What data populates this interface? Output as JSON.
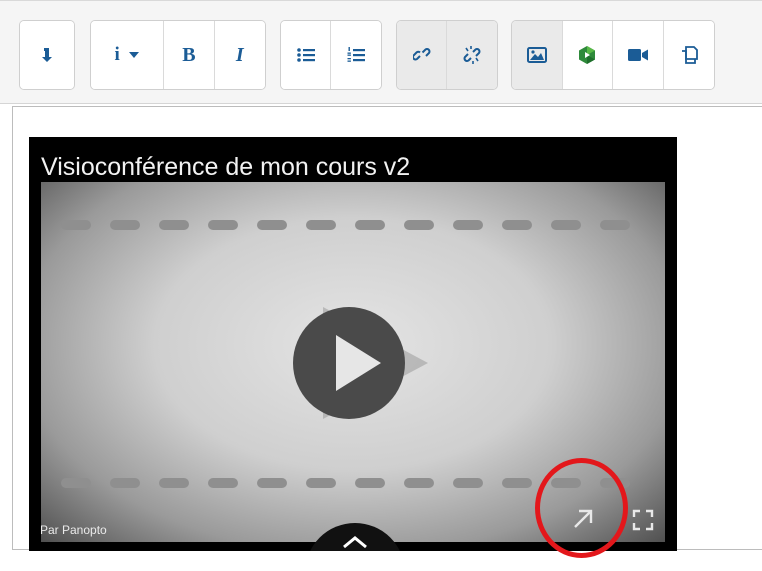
{
  "toolbar": {
    "groups": [
      {
        "buttons": [
          {
            "name": "collapse-toolbar",
            "icon": "arrow-down-icon"
          }
        ]
      },
      {
        "buttons": [
          {
            "name": "paragraph-styles",
            "label": "i",
            "icon": "info-icon"
          },
          {
            "name": "bold",
            "label": "B"
          },
          {
            "name": "italic",
            "label": "I"
          }
        ]
      },
      {
        "buttons": [
          {
            "name": "unordered-list",
            "icon": "bulleted-list-icon"
          },
          {
            "name": "ordered-list",
            "icon": "numbered-list-icon"
          }
        ]
      },
      {
        "buttons": [
          {
            "name": "link",
            "icon": "link-icon"
          },
          {
            "name": "unlink",
            "icon": "unlink-icon"
          }
        ]
      },
      {
        "buttons": [
          {
            "name": "insert-image",
            "icon": "image-icon"
          },
          {
            "name": "insert-media",
            "icon": "panopto-logo-icon"
          },
          {
            "name": "record-video",
            "icon": "video-camera-icon"
          },
          {
            "name": "manage-files",
            "icon": "files-icon"
          }
        ]
      }
    ]
  },
  "player": {
    "title": "Visioconférence de mon cours v2",
    "provider_label": "Par Panopto",
    "play_icon": "play-icon",
    "open_icon": "open-external-arrow-icon",
    "fullscreen_icon": "fullscreen-icon",
    "expand_icon": "chevron-up-icon"
  },
  "colors": {
    "toolbar_icon": "#1b5c96",
    "highlight_ring": "#e3171b",
    "player_background": "#000000"
  }
}
